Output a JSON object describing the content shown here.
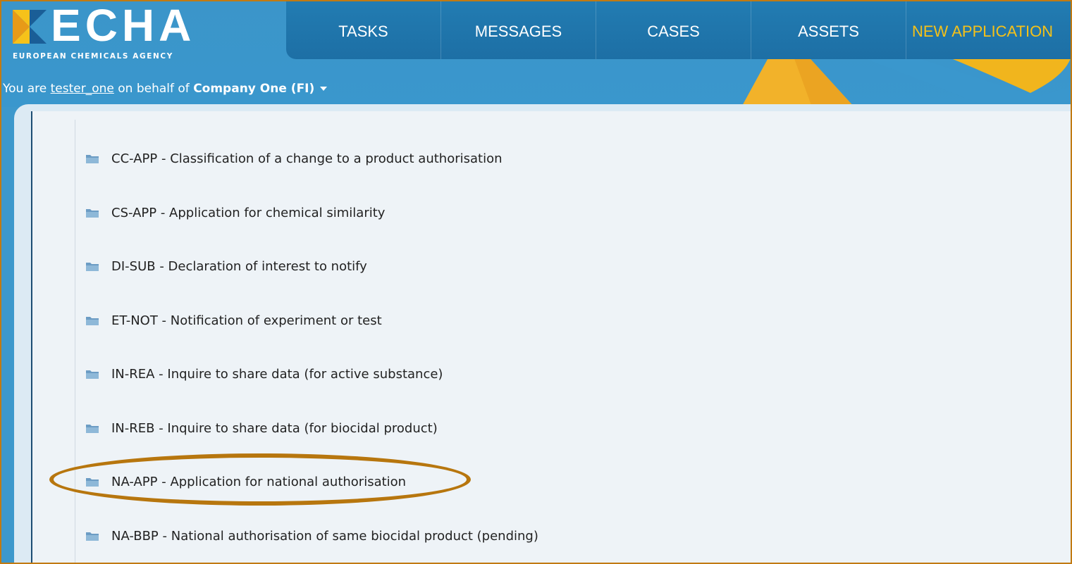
{
  "logo": {
    "text": "ECHA",
    "subtitle": "EUROPEAN CHEMICALS AGENCY"
  },
  "nav": {
    "items": [
      {
        "label": "TASKS"
      },
      {
        "label": "MESSAGES"
      },
      {
        "label": "CASES"
      },
      {
        "label": "ASSETS"
      },
      {
        "label": "NEW APPLICATION"
      }
    ]
  },
  "userbar": {
    "prefix": "You are",
    "user": "tester_one",
    "middle": "on behalf of",
    "company": "Company One (FI)"
  },
  "list": {
    "items": [
      {
        "label": "CC-APP - Classification of a change to a product authorisation"
      },
      {
        "label": "CS-APP - Application for chemical similarity"
      },
      {
        "label": "DI-SUB - Declaration of interest to notify"
      },
      {
        "label": "ET-NOT - Notification of experiment or test"
      },
      {
        "label": "IN-REA - Inquire to share data (for active substance)"
      },
      {
        "label": "IN-REB - Inquire to share data (for biocidal product)"
      },
      {
        "label": "NA-APP - Application for national authorisation"
      },
      {
        "label": "NA-BBP - National authorisation of same biocidal product (pending)"
      }
    ]
  },
  "colors": {
    "header_blue": "#3a97cd",
    "nav_blue": "#1d6fa5",
    "accent_yellow": "#f5c118",
    "highlight": "#b7760e"
  }
}
